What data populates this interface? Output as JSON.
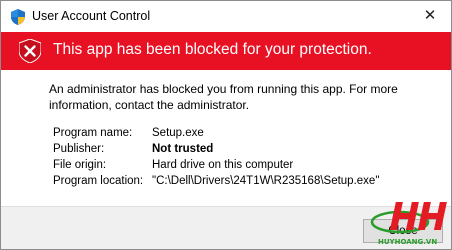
{
  "window": {
    "title": "User Account Control",
    "close_glyph": "✕"
  },
  "banner": {
    "text": "This app has been blocked for your protection.",
    "color": "#e81123",
    "icon": "blocked-shield-x-icon"
  },
  "message": "An administrator has blocked you from running this app. For more information, contact the administrator.",
  "details": [
    {
      "label": "Program name:",
      "value": "Setup.exe",
      "bold": false
    },
    {
      "label": "Publisher:",
      "value": "Not trusted",
      "bold": true
    },
    {
      "label": "File origin:",
      "value": "Hard drive on this computer",
      "bold": false
    },
    {
      "label": "Program location:",
      "value": "\"C:\\Dell\\Drivers\\24T1W\\R235168\\Setup.exe\"",
      "bold": false
    }
  ],
  "footer": {
    "close_label": "Close"
  },
  "watermark": {
    "mark": "HH",
    "site": "HUYHOANG.VN"
  }
}
